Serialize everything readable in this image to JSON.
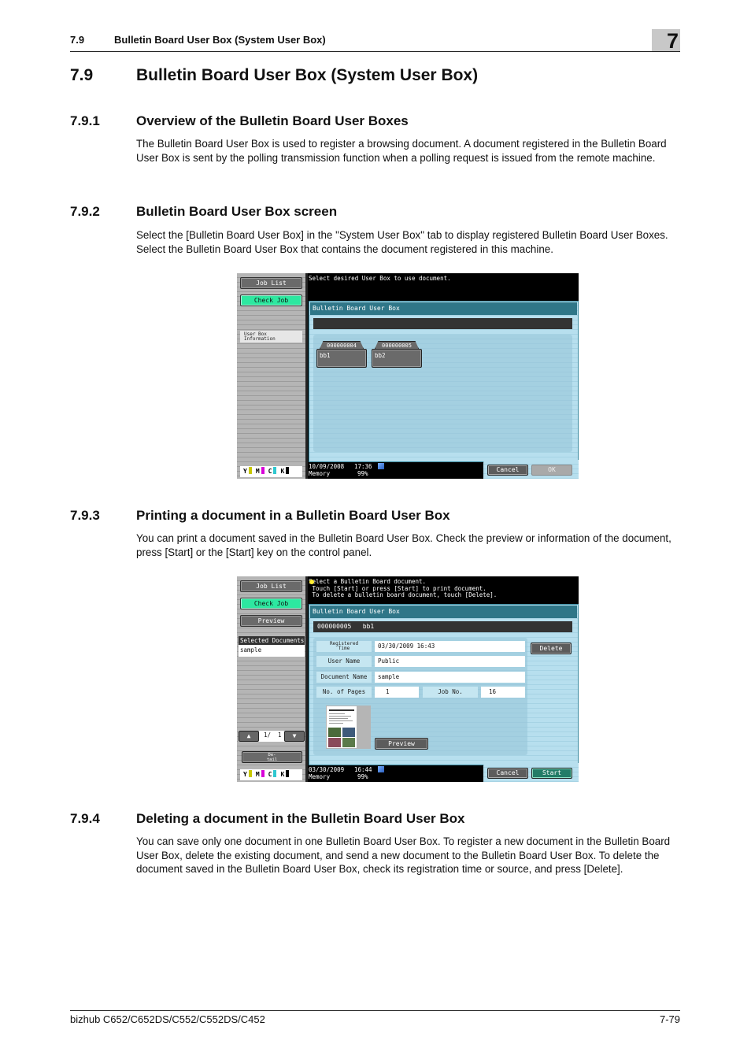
{
  "header": {
    "section_number": "7.9",
    "section_title": "Bulletin Board User Box (System User Box)",
    "chapter": "7"
  },
  "title": {
    "number": "7.9",
    "text": "Bulletin Board User Box (System User Box)"
  },
  "sections": [
    {
      "number": "7.9.1",
      "title": "Overview of the Bulletin Board User Boxes",
      "body": "The Bulletin Board User Box is used to register a browsing document. A document registered in the Bulletin Board User Box is sent by the polling transmission function when a polling request is issued from the remote machine."
    },
    {
      "number": "7.9.2",
      "title": "Bulletin Board User Box screen",
      "body": "Select the [Bulletin Board User Box] in the \"System User Box\" tab to display registered Bulletin Board User Boxes. Select the Bulletin Board User Box that contains the document registered in this machine."
    },
    {
      "number": "7.9.3",
      "title": "Printing a document in a Bulletin Board User Box",
      "body": "You can print a document saved in the Bulletin Board User Box. Check the preview or information of the document, press [Start] or the [Start] key on the control panel."
    },
    {
      "number": "7.9.4",
      "title": "Deleting a document in the Bulletin Board User Box",
      "body": "You can save only one document in one Bulletin Board User Box. To register a new document in the Bulletin Board User Box, delete the existing document, and send a new document to the Bulletin Board User Box. To delete the document saved in the Bulletin Board User Box, check its registration time or source, and press [Delete]."
    }
  ],
  "screen1": {
    "job_list": "Job List",
    "check_job": "Check Job",
    "user_box_info": "User Box\nInformation",
    "message": "Select desired User Box to use document.",
    "panel_title": "Bulletin Board User Box",
    "boxes": [
      {
        "number": "000000004",
        "name": "bb1"
      },
      {
        "number": "000000005",
        "name": "bb2"
      }
    ],
    "date": "10/09/2008",
    "time": "17:36",
    "memory_label": "Memory",
    "memory_value": "99%",
    "cancel": "Cancel",
    "ok": "OK",
    "toner": [
      "Y",
      "M",
      "C",
      "K"
    ]
  },
  "screen2": {
    "job_list": "Job List",
    "check_job": "Check Job",
    "preview_side": "Preview",
    "selected_documents_header": "Selected Documents",
    "selected_document": "sample",
    "page_indicator": "1/  1",
    "detail": "De-\ntail",
    "message": "Select a Bulletin Board document.\n Touch [Start] or press [Start] to print document.\n To delete a bulletin board document, touch [Delete].",
    "panel_title": "Bulletin Board User Box",
    "box_bar": "000000005   bb1",
    "fields": {
      "registered_time_label": "Registered\nTime",
      "registered_time": "03/30/2009 16:43",
      "user_name_label": "User Name",
      "user_name": "Public",
      "document_name_label": "Document Name",
      "document_name": "sample",
      "pages_label": "No. of Pages",
      "pages": "1",
      "job_no_label": "Job No.",
      "job_no": "16"
    },
    "delete": "Delete",
    "preview": "Preview",
    "date": "03/30/2009",
    "time": "16:44",
    "memory_label": "Memory",
    "memory_value": "99%",
    "cancel": "Cancel",
    "start": "Start",
    "toner": [
      "Y",
      "M",
      "C",
      "K"
    ]
  },
  "toner_colors": {
    "Y": "#c8c800",
    "M": "#d800d8",
    "C": "#30c8d0",
    "K": "#000000"
  },
  "footer": {
    "model": "bizhub C652/C652DS/C552/C552DS/C452",
    "page": "7-79"
  }
}
